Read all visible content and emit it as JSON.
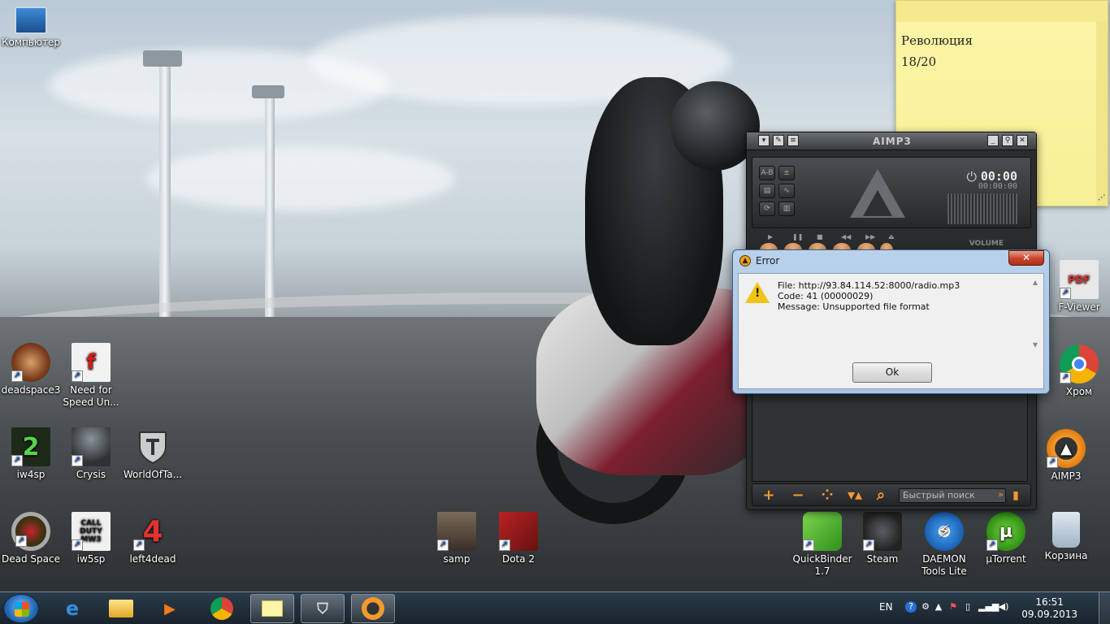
{
  "desktop": {
    "icons": [
      {
        "label": "Компьютер",
        "icon": "computer-icon"
      },
      {
        "label": "deadspace3",
        "icon": "deadspace3-icon"
      },
      {
        "label": "Need for Speed Un...",
        "icon": "need-for-speed-icon"
      },
      {
        "label": "iw4sp",
        "icon": "iw4sp-icon"
      },
      {
        "label": "Crysis",
        "icon": "crysis-icon"
      },
      {
        "label": "WorldOfTa...",
        "icon": "world-of-tanks-icon"
      },
      {
        "label": "Dead Space",
        "icon": "dead-space-icon"
      },
      {
        "label": "iw5sp",
        "icon": "iw5sp-icon"
      },
      {
        "label": "left4dead",
        "icon": "left4dead-icon"
      },
      {
        "label": "samp",
        "icon": "samp-icon"
      },
      {
        "label": "Dota 2",
        "icon": "dota2-icon"
      },
      {
        "label": "QuickBinder 1.7",
        "icon": "quickbinder-icon"
      },
      {
        "label": "Steam",
        "icon": "steam-icon"
      },
      {
        "label": "DAEMON Tools Lite",
        "icon": "daemon-tools-icon"
      },
      {
        "label": "µTorrent",
        "icon": "utorrent-icon"
      },
      {
        "label": "Корзина",
        "icon": "recycle-bin-icon"
      },
      {
        "label": "F-Viewer",
        "icon": "pdf-viewer-icon"
      },
      {
        "label": "Хром",
        "icon": "chrome-icon"
      },
      {
        "label": "AIMP3",
        "icon": "aimp3-icon"
      }
    ],
    "icon_badges": {
      "pdf": "PDF",
      "left4dead": "4",
      "iw4sp": "2",
      "cod": "CALL DUTY MW3"
    }
  },
  "sticky_note": {
    "line1": "Революция",
    "line2": "18/20",
    "color": "#fdf6a8"
  },
  "aimp": {
    "title": "AIMP3",
    "time_main": "00:00",
    "time_sub": "00:00:00",
    "volume_label": "VOLUME",
    "search_placeholder": "Быстрый поиск",
    "accent_color": "#f39a2e",
    "display_buttons": [
      "A-B",
      "+|-",
      "repeat",
      "shuffle",
      "eq",
      "visual"
    ]
  },
  "error_dialog": {
    "title": "Error",
    "close_label": "✕",
    "file_line": "File: http://93.84.114.52:8000/radio.mp3",
    "code_line": "Code: 41 (00000029)",
    "message_line": "Message: Unsupported file format",
    "ok_label": "Ok"
  },
  "taskbar": {
    "pinned": [
      "start-button",
      "internet-explorer",
      "windows-explorer",
      "media-player",
      "chrome",
      "sticky-notes",
      "world-of-tanks",
      "aimp3"
    ],
    "tray": {
      "language": "EN",
      "time": "16:51",
      "date": "09.09.2013"
    }
  }
}
